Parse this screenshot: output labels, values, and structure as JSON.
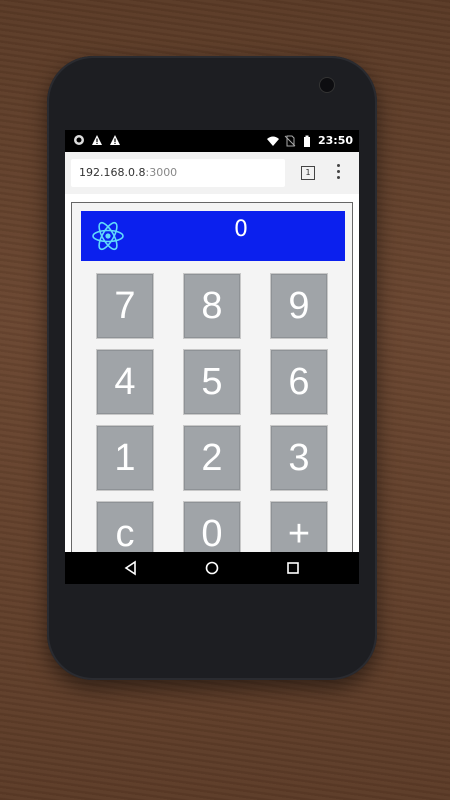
{
  "statusbar": {
    "time": "23:50",
    "left_icons": [
      "sync-icon",
      "warning-icon",
      "warning-icon"
    ],
    "right_icons": [
      "wifi-icon",
      "no-sim-icon",
      "battery-icon"
    ]
  },
  "browser": {
    "url_host": "192.168.0.8",
    "url_port": ":3000",
    "tab_count": "1",
    "menu_icon": "more-vert-icon"
  },
  "calculator": {
    "logo_icon": "react-logo-icon",
    "display_value": "0",
    "display_color": "#0b20ee",
    "keys": [
      "7",
      "8",
      "9",
      "4",
      "5",
      "6",
      "1",
      "2",
      "3",
      "c",
      "0",
      "+"
    ]
  },
  "navbar": {
    "icons": [
      "back-icon",
      "home-icon",
      "recents-icon"
    ]
  }
}
